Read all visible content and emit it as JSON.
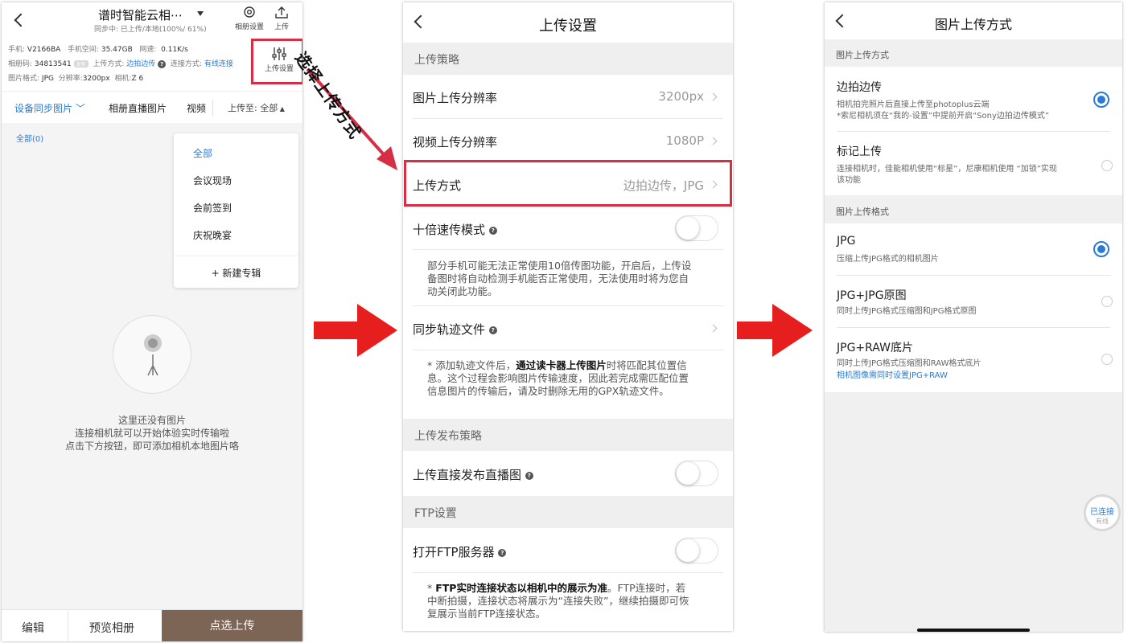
{
  "phone1": {
    "title": "谱时智能云相⋯",
    "subtitle": "同步中: 已上传/本地(100%/ 61%)",
    "tool_album_settings": "相册设置",
    "tool_upload": "上传",
    "tool_upload_settings": "上传设置",
    "info": {
      "phone_label": "手机:",
      "phone_value": "V2166BA",
      "space_label": "手机空间:",
      "space_value": "35.47GB",
      "speed_label": "网速:",
      "speed_value": "0.11K/s",
      "album_code_label": "相册码:",
      "album_code_value": "34813541",
      "chip": "发布",
      "upload_mode_label": "上传方式:",
      "upload_mode_value": "边拍边传",
      "conn_label": "连接方式:",
      "conn_value": "有线连接",
      "format_label": "图片格式:",
      "format_value": "JPG",
      "resolution_label": "分辨率:",
      "resolution_value": "3200px",
      "camera_label": "相机:",
      "camera_value": "Z 6"
    },
    "tabs": [
      "设备同步图片",
      "相册直播图片",
      "视频"
    ],
    "upload_to": "上传至: 全部",
    "filter_all": "全部(0)",
    "dropdown": {
      "items": [
        "全部",
        "会议现场",
        "会前签到",
        "庆祝晚宴"
      ],
      "new_album": "+ 新建专辑"
    },
    "empty": {
      "line1": "这里还没有图片",
      "line2": "连接相机就可以开始体验实时传输啦",
      "line3": "点击下方按钮，即可添加相机本地图片咯"
    },
    "bottom": {
      "edit": "编辑",
      "preview": "预览相册",
      "select_upload": "点选上传"
    }
  },
  "annotation": "选择上传方式",
  "phone2": {
    "title": "上传设置",
    "section_strategy": "上传策略",
    "image_res_label": "图片上传分辨率",
    "image_res_value": "3200px",
    "video_res_label": "视频上传分辨率",
    "video_res_value": "1080P",
    "upload_mode_label": "上传方式",
    "upload_mode_value": "边拍边传，JPG",
    "speed_mode_label": "十倍速传模式",
    "speed_mode_desc": "部分手机可能无法正常使用10倍传图功能，开启后，上传设备图时将自动检测手机能否正常使用，无法使用时将为您自动关闭此功能。",
    "track_label": "同步轨迹文件",
    "track_desc_pre": "* 添加轨迹文件后，",
    "track_desc_bold": "通过读卡器上传图片",
    "track_desc_post": "时将匹配其位置信息。这个过程会影响图片传输速度，因此若完成需匹配位置信息图片的传输后，请及时删除无用的GPX轨迹文件。",
    "section_publish": "上传发布策略",
    "publish_label": "上传直接发布直播图",
    "section_ftp": "FTP设置",
    "ftp_label": "打开FTP服务器",
    "ftp_desc_pre": "* ",
    "ftp_desc_bold": "FTP实时连接状态以相机中的展示为准",
    "ftp_desc_post": "。FTP连接时，若中断拍摄，连接状态将展示为“连接失败”，继续拍摄即可恢复展示当前FTP连接状态。"
  },
  "phone3": {
    "title": "图片上传方式",
    "section_mode": "图片上传方式",
    "opt1_label": "边拍边传",
    "opt1_desc1": "相机拍完照片后直接上传至photoplus云端",
    "opt1_desc2": "*索尼相机须在“我的-设置”中提前开启“Sony边拍边传模式”",
    "opt2_label": "标记上传",
    "opt2_desc1": "连接相机时，佳能相机使用“标星”，尼康相机使用 “加锁”实现",
    "opt2_desc2": "该功能",
    "section_format": "图片上传格式",
    "fmt1_label": "JPG",
    "fmt1_desc": "压缩上传JPG格式的相机图片",
    "fmt2_label": "JPG+JPG原图",
    "fmt2_desc": "同时上传JPG格式压缩图和JPG格式原图",
    "fmt3_label": "JPG+RAW底片",
    "fmt3_desc": "同时上传JPG格式压缩图和RAW格式底片",
    "fmt3_note": "相机图像需同时设置JPG+RAW",
    "conn_line1": "已连接",
    "conn_line2": "有线"
  },
  "colors": {
    "accent": "#2a7bd6",
    "highlight": "#d62f45",
    "primary_btn": "#7d6556"
  }
}
